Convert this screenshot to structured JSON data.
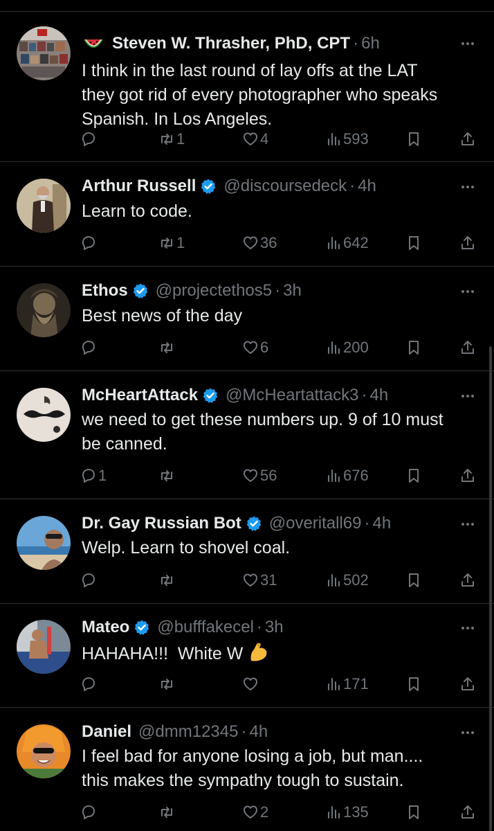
{
  "tweets": [
    {
      "name": "Steven W. Thrasher, PhD, CPT",
      "prefix_emoji": "watermelon",
      "verified": false,
      "handle": "",
      "time": "6h",
      "text": "I think in the last round of lay offs at the LAT\nthey got rid of every photographer who speaks\nSpanish. In Los Angeles.",
      "replies": "",
      "retweets": "1",
      "likes": "4",
      "views": "593"
    },
    {
      "name": "Arthur Russell",
      "verified": true,
      "handle": "@discoursedeck",
      "time": "4h",
      "text": "Learn to code.",
      "replies": "",
      "retweets": "1",
      "likes": "36",
      "views": "642"
    },
    {
      "name": "Ethos",
      "verified": true,
      "handle": "@projectethos5",
      "time": "3h",
      "text": "Best news of the day",
      "replies": "",
      "retweets": "",
      "likes": "6",
      "views": "200"
    },
    {
      "name": "McHeartAttack",
      "verified": true,
      "handle": "@McHeartattack3",
      "time": "4h",
      "text": "we need to get these numbers up. 9 of 10 must\nbe canned.",
      "replies": "1",
      "retweets": "",
      "likes": "56",
      "views": "676"
    },
    {
      "name": "Dr. Gay Russian Bot",
      "verified": true,
      "handle": "@overitall69",
      "time": "4h",
      "text": "Welp. Learn to shovel coal.",
      "replies": "",
      "retweets": "",
      "likes": "31",
      "views": "502"
    },
    {
      "name": "Mateo",
      "verified": true,
      "handle": "@bufffakecel",
      "time": "3h",
      "text": "HAHAHA!!!  White W",
      "trailing_emoji": "flexed-biceps",
      "replies": "",
      "retweets": "",
      "likes": "",
      "views": "171"
    },
    {
      "name": "Daniel",
      "verified": false,
      "handle": "@dmm12345",
      "time": "4h",
      "text": "I feel bad for anyone losing a job, but man....\nthis makes the sympathy tough to sustain.",
      "replies": "",
      "retweets": "",
      "likes": "2",
      "views": "135"
    }
  ],
  "icons": {
    "reply": "reply-icon",
    "retweet": "retweet-icon",
    "like": "heart-icon",
    "views": "views-icon",
    "bookmark": "bookmark-icon",
    "share": "share-icon",
    "more": "more-icon",
    "verified": "verified-badge-icon"
  },
  "colors": {
    "background": "#000000",
    "text": "#e7e9ea",
    "muted": "#71767b",
    "divider": "#2f3336",
    "verified": "#1d9bf0"
  }
}
